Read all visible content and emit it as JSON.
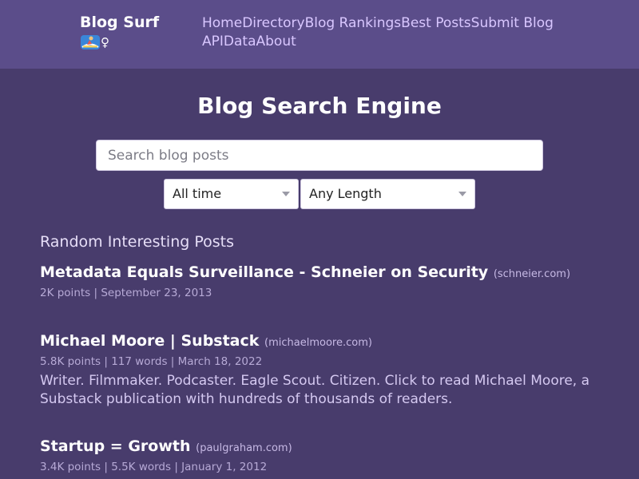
{
  "header": {
    "brand": "Blog Surf",
    "brand_emoji": "🏄‍♀️",
    "nav": [
      {
        "label": "Home"
      },
      {
        "label": "Directory"
      },
      {
        "label": "Blog Rankings"
      },
      {
        "label": "Best Posts"
      },
      {
        "label": "Submit Blog"
      },
      {
        "label": "API"
      },
      {
        "label": "Data"
      },
      {
        "label": "About"
      }
    ]
  },
  "page": {
    "title": "Blog Search Engine",
    "search_placeholder": "Search blog posts"
  },
  "filters": {
    "time": "All time",
    "length": "Any Length"
  },
  "section": {
    "heading": "Random Interesting Posts"
  },
  "posts": [
    {
      "title": "Metadata Equals Surveillance - Schneier on Security",
      "domain": "(schneier.com)",
      "meta": "2K points | September 23, 2013",
      "desc": ""
    },
    {
      "title": "Michael Moore | Substack",
      "domain": "(michaelmoore.com)",
      "meta": "5.8K points | 117 words | March 18, 2022",
      "desc": "Writer. Filmmaker. Podcaster. Eagle Scout. Citizen. Click to read Michael Moore, a Substack publication with hundreds of thousands of readers."
    },
    {
      "title": "Startup = Growth",
      "domain": "(paulgraham.com)",
      "meta": "3.4K points | 5.5K words | January 1, 2012",
      "desc": ""
    }
  ],
  "colors": {
    "header_bg": "#5b4d8a",
    "page_bg": "#483c6c",
    "nav_link": "#d9c7ff"
  }
}
